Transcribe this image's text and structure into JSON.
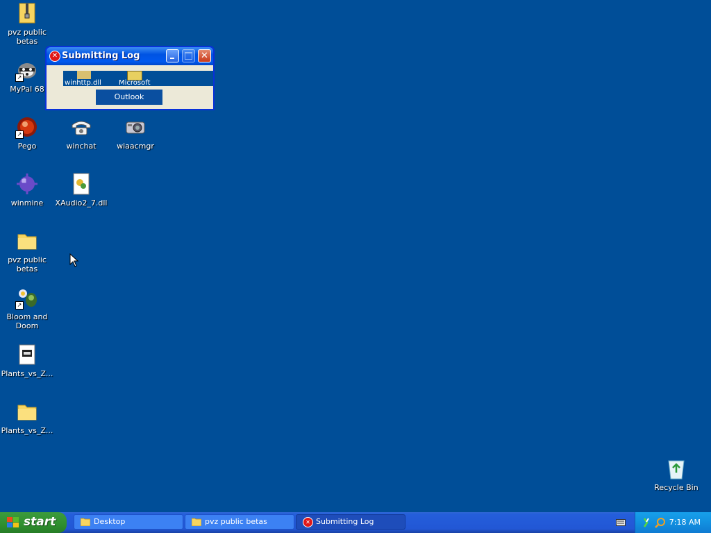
{
  "desktop": {
    "icons": [
      {
        "label": "pvz public betas",
        "icon": "zip-folder-icon"
      },
      {
        "label": "MyPal 68",
        "icon": "raccoon-icon"
      },
      {
        "label": "Pego",
        "icon": "pego-icon"
      },
      {
        "label": "winchat",
        "icon": "telephone-icon"
      },
      {
        "label": "wiaacmgr",
        "icon": "camera-icon"
      },
      {
        "label": "winmine",
        "icon": "mine-icon"
      },
      {
        "label": "XAudio2_7.dll",
        "icon": "dll-file-icon"
      },
      {
        "label": "pvz public betas",
        "icon": "folder-icon"
      },
      {
        "label": "Bloom and Doom",
        "icon": "plant-icon"
      },
      {
        "label": "Plants_vs_Z...",
        "icon": "exe-file-icon"
      },
      {
        "label": "Plants_vs_Z...",
        "icon": "folder-icon"
      },
      {
        "label": "Recycle Bin",
        "icon": "recycle-bin-icon"
      }
    ]
  },
  "window": {
    "title": "Submitting Log",
    "ghost_text_1": "Microsoft",
    "ghost_text_2": "Outlook",
    "ghost_text_3": "winhttp.dll"
  },
  "taskbar": {
    "start_label": "start",
    "tasks": [
      {
        "label": "Desktop",
        "icon": "folder-icon"
      },
      {
        "label": "pvz public betas",
        "icon": "folder-icon"
      },
      {
        "label": "Submitting Log",
        "icon": "error-icon"
      }
    ],
    "clock": "7:18 AM"
  },
  "colors": {
    "desktop_bg": "#004E98",
    "taskbar": "#245EDB",
    "start_green": "#2F8F2F",
    "tray": "#1290E0"
  }
}
